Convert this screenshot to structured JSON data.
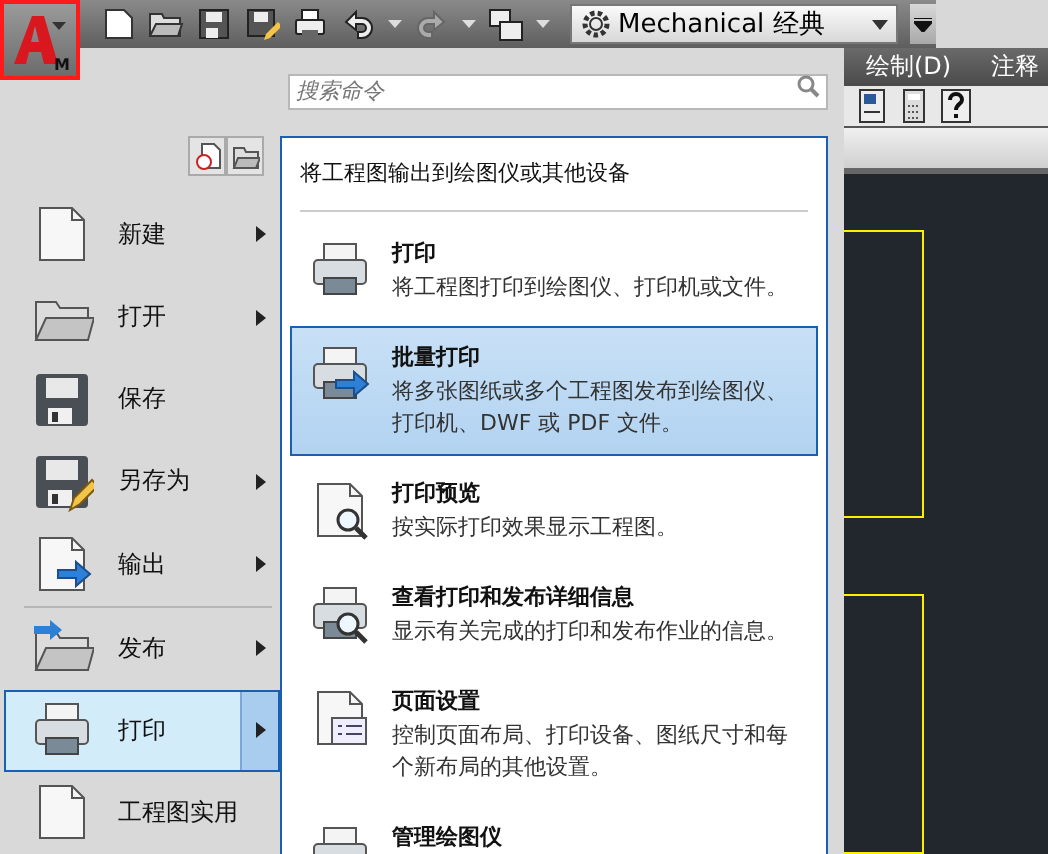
{
  "app_button": {
    "badge": "M",
    "open": true
  },
  "quick_access": {
    "workspace": "Mechanical 经典"
  },
  "search": {
    "placeholder": "搜索命令"
  },
  "menu_bar": [
    "绘制(D)",
    "注释"
  ],
  "app_menu": {
    "items": [
      {
        "label": "新建",
        "submenu": true,
        "selected": false
      },
      {
        "label": "打开",
        "submenu": true,
        "selected": false
      },
      {
        "label": "保存",
        "submenu": false,
        "selected": false
      },
      {
        "label": "另存为",
        "submenu": true,
        "selected": false
      },
      {
        "label": "输出",
        "submenu": true,
        "selected": false
      },
      {
        "label": "发布",
        "submenu": true,
        "selected": false
      },
      {
        "label": "打印",
        "submenu": true,
        "selected": true
      },
      {
        "label": "工程图实用",
        "submenu": false,
        "selected": false
      }
    ]
  },
  "submenu": {
    "title": "将工程图输出到绘图仪或其他设备",
    "items": [
      {
        "title": "打印",
        "description": "将工程图打印到绘图仪、打印机或文件。",
        "selected": false
      },
      {
        "title": "批量打印",
        "description": "将多张图纸或多个工程图发布到绘图仪、打印机、DWF 或 PDF 文件。",
        "selected": true
      },
      {
        "title": "打印预览",
        "description": "按实际打印效果显示工程图。",
        "selected": false
      },
      {
        "title": "查看打印和发布详细信息",
        "description": "显示有关完成的打印和发布作业的信息。",
        "selected": false
      },
      {
        "title": "页面设置",
        "description": "控制页面布局、打印设备、图纸尺寸和每个新布局的其他设置。",
        "selected": false
      },
      {
        "title": "管理绘图仪",
        "selected": false
      }
    ]
  }
}
